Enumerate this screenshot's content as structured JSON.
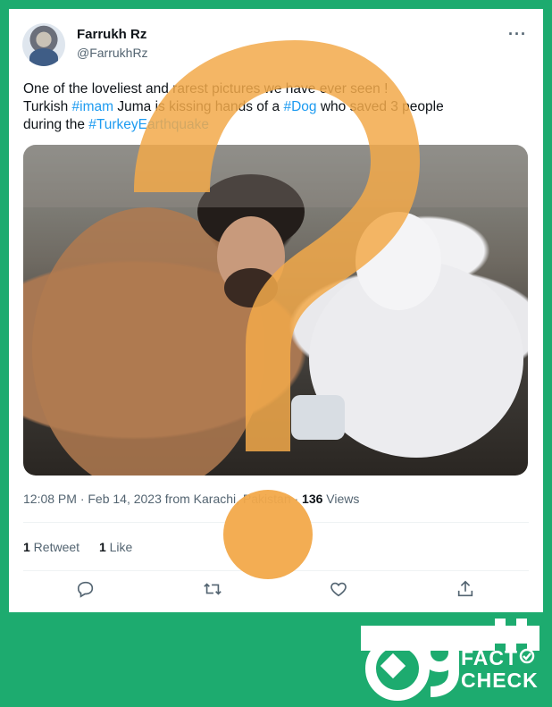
{
  "tweet": {
    "author_name": "Farrukh Rz",
    "author_handle": "@FarrukhRz",
    "more_label": "···",
    "text_line1": "One of the loveliest and rarest pictures we have ever seen !",
    "text_line2_pre": "Turkish ",
    "hashtag_imam": "#imam",
    "text_line2_mid": " Juma is kissing hands of a ",
    "hashtag_dog": "#Dog",
    "text_line2_post": " who saved 3 people",
    "text_line3_pre": "during the ",
    "hashtag_quake": "#TurkeyEarthquake",
    "timestamp": "12:08 PM · Feb 14, 2023 from Karachi, Pakistan · ",
    "views_count": "136",
    "views_label": " Views",
    "retweet_count": "1",
    "retweet_label": " Retweet",
    "like_count": "1",
    "like_label": " Like"
  },
  "icons": {
    "reply": "reply-icon",
    "retweet": "retweet-icon",
    "like": "heart-icon",
    "share": "share-icon"
  },
  "watermark": {
    "brand_line1": "FACT",
    "brand_line2": "CHECK",
    "question_color": "#f2a94a"
  },
  "colors": {
    "background": "#1dab6f",
    "link": "#1d9bf0"
  }
}
